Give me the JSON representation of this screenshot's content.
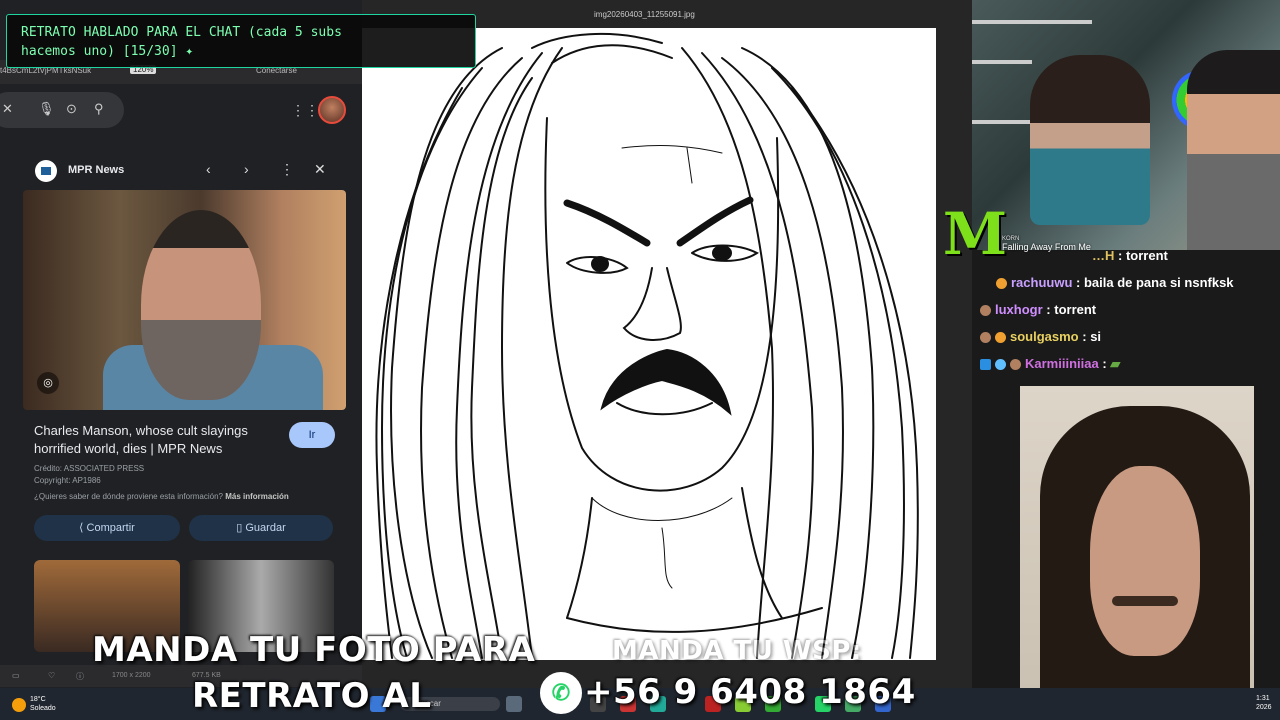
{
  "banner": {
    "line1": "RETRATO HABLADO PARA EL CHAT (cada 5 subs",
    "line2": "hacemos uno) [15/30]"
  },
  "browser": {
    "url_fragment": "t4BsCmL2tVjPMTksNSuk",
    "zoom": "120%",
    "connect_label": "Conectarse"
  },
  "card": {
    "source": "MPR News",
    "caption": "Charles Manson, whose cult slayings horrified world, dies | MPR News",
    "go_label": "Ir",
    "credit": "Crédito: ASSOCIATED PRESS",
    "copyright": "Copyright: AP1986",
    "question": "¿Quieres saber de dónde proviene esta información?",
    "more_info": "Más información",
    "share_label": "Compartir",
    "save_label": "Guardar"
  },
  "viewer": {
    "file_name": "img20260403_11255091.jpg",
    "dimensions": "1700 x 2200",
    "file_size": "677.5 KB"
  },
  "music": {
    "artist": "KORN",
    "title": "Falling Away From Me"
  },
  "chat": [
    {
      "nick": "…H",
      "message": "torrent"
    },
    {
      "nick": "rachuuwu",
      "message": "baila de pana si nsnfksk"
    },
    {
      "nick": "luxhogr",
      "message": "torrent"
    },
    {
      "nick": "soulgasmo",
      "message": "si"
    },
    {
      "nick": "Karmiiiniiaa",
      "message": ""
    }
  ],
  "overlay": {
    "left_line1": "MANDA TU FOTO PARA",
    "left_line2": "RETRATO AL",
    "right_line1": "MANDA TU WSP:",
    "phone": "+56 9 6408 1864"
  },
  "taskbar": {
    "temperature": "18°C",
    "weather": "Soleado",
    "search": "Buscar",
    "time": "1:31",
    "year": "2026"
  },
  "colors": {
    "banner_text": "#7dffb2",
    "banner_border": "#1fd6a0",
    "whatsapp": "#25d366",
    "monster_green": "#7ee01a",
    "button_blue": "#a8c7fa"
  }
}
